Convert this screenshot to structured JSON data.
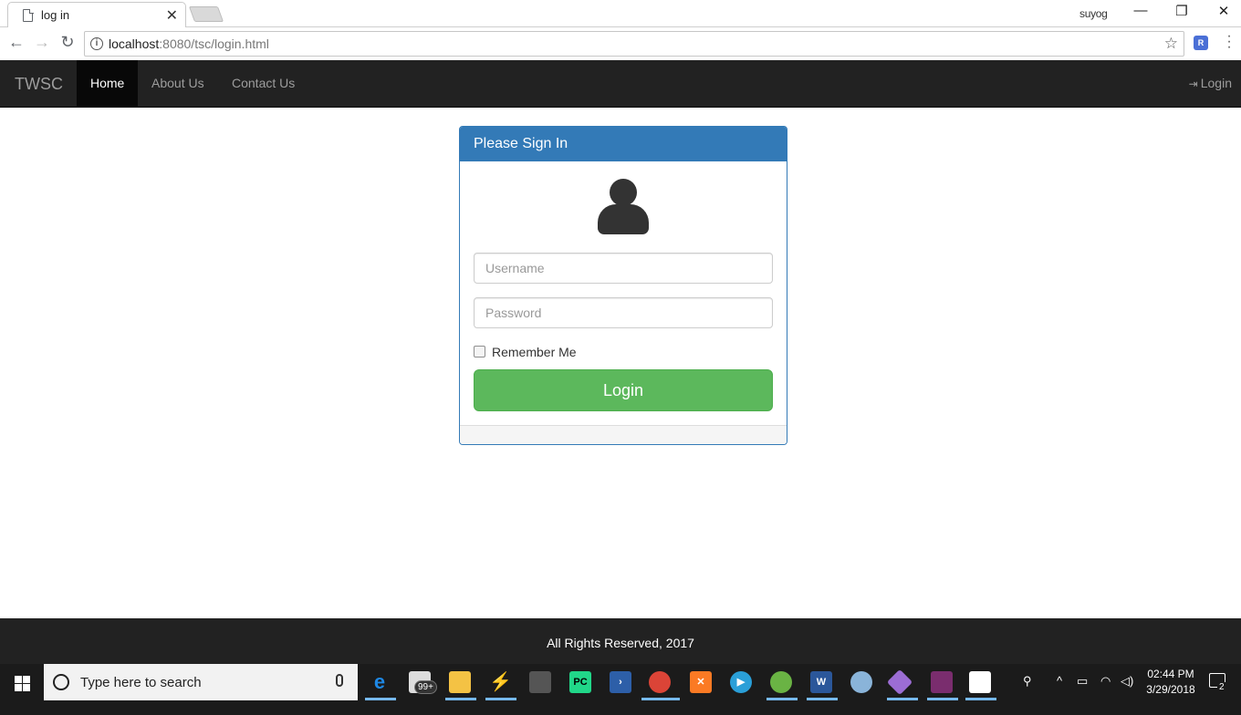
{
  "browser": {
    "tab_title": "log in",
    "tab_close": "✕",
    "profile_name": "suyog",
    "url_host": "localhost",
    "url_rest": ":8080/tsc/login.html",
    "extension_label": "R"
  },
  "navbar": {
    "brand": "TWSC",
    "links": [
      "Home",
      "About Us",
      "Contact Us"
    ],
    "active_index": 0,
    "login_label": "Login"
  },
  "panel": {
    "heading": "Please Sign In",
    "username_placeholder": "Username",
    "password_placeholder": "Password",
    "remember_label": "Remember Me",
    "remember_checked": false,
    "submit_label": "Login"
  },
  "footer": {
    "text": "All Rights Reserved, 2017"
  },
  "taskbar": {
    "search_placeholder": "Type here to search",
    "badge": "99+",
    "clock_time": "02:44 PM",
    "clock_date": "3/29/2018",
    "notification_count": "2"
  },
  "colors": {
    "navbar_bg": "#222222",
    "panel_primary": "#337ab7",
    "login_button": "#5cb85c",
    "taskbar_bg": "#1b1b1b"
  },
  "taskbar_icons": [
    "edge-icon",
    "mail-icon",
    "file-explorer-icon",
    "lightning-app-icon",
    "notepad-icon",
    "pycharm-icon",
    "powershell-icon",
    "chrome-icon",
    "xampp-icon",
    "media-player-icon",
    "android-studio-icon",
    "word-icon",
    "paint-icon",
    "git-icon",
    "game-icon",
    "store-icon"
  ]
}
